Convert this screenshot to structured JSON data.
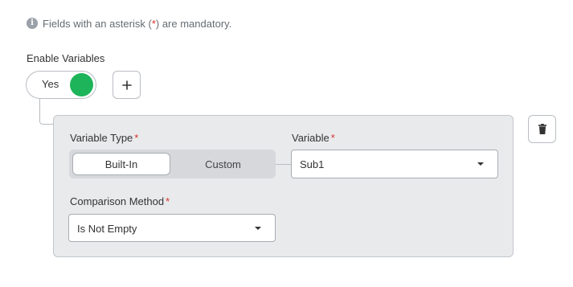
{
  "info": {
    "icon": "info-icon",
    "text_before": "Fields with an asterisk (",
    "asterisk": "*",
    "text_after": ") are mandatory."
  },
  "enable_variables": {
    "label": "Enable Variables",
    "toggle_value": "Yes",
    "toggle_on": true,
    "toggle_color": "#1eb45a"
  },
  "add_button": {
    "icon": "plus-icon"
  },
  "delete_button": {
    "icon": "trash-icon"
  },
  "panel": {
    "variable_type": {
      "label": "Variable Type",
      "required_mark": "*",
      "options": [
        "Built-In",
        "Custom"
      ],
      "selected": "Built-In"
    },
    "variable": {
      "label": "Variable",
      "required_mark": "*",
      "value": "Sub1"
    },
    "comparison_method": {
      "label": "Comparison Method",
      "required_mark": "*",
      "value": "Is Not Empty"
    }
  },
  "colors": {
    "required": "#d9322e",
    "panel_bg": "#e9eaec",
    "toggle_on": "#1eb45a"
  }
}
